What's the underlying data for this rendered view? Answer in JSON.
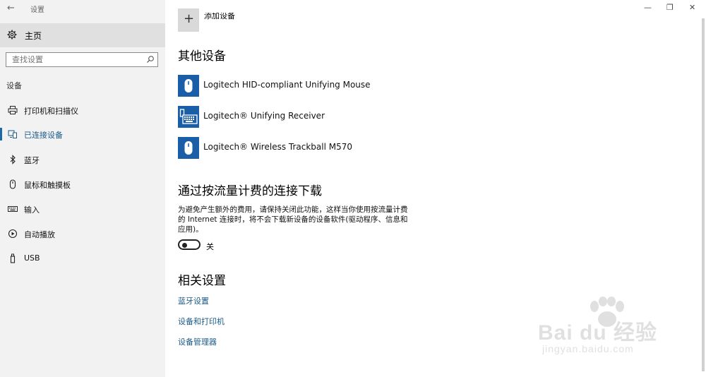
{
  "window": {
    "title": "设置"
  },
  "sidebar": {
    "home_label": "主页",
    "search_placeholder": "查找设置",
    "section": "设备",
    "items": [
      {
        "label": "打印机和扫描仪",
        "icon": "printer-icon"
      },
      {
        "label": "已连接设备",
        "icon": "connected-devices-icon",
        "active": true
      },
      {
        "label": "蓝牙",
        "icon": "bluetooth-icon"
      },
      {
        "label": "鼠标和触摸板",
        "icon": "mouse-icon"
      },
      {
        "label": "输入",
        "icon": "keyboard-icon"
      },
      {
        "label": "自动播放",
        "icon": "autoplay-icon"
      },
      {
        "label": "USB",
        "icon": "usb-icon"
      }
    ]
  },
  "main": {
    "add_device_label": "添加设备",
    "other_devices": {
      "heading": "其他设备",
      "devices": [
        {
          "name": "Logitech HID-compliant Unifying Mouse",
          "icon": "mouse-icon"
        },
        {
          "name": "Logitech® Unifying Receiver",
          "icon": "keyboard-icon"
        },
        {
          "name": "Logitech® Wireless Trackball M570",
          "icon": "mouse-icon"
        }
      ]
    },
    "metered": {
      "heading": "通过按流量计费的连接下载",
      "description": "为避免产生额外的费用，请保持关闭此功能，这样当你使用按流量计费的 Internet 连接时，将不会下载新设备的设备软件(驱动程序、信息和应用)。",
      "toggle_state": "关"
    },
    "related": {
      "heading": "相关设置",
      "links": [
        "蓝牙设置",
        "设备和打印机",
        "设备管理器"
      ]
    }
  },
  "watermark": {
    "logo": "Bai du 经验",
    "url": "jingyan.baidu.com"
  },
  "colors": {
    "accent": "#1a5a8a",
    "tile": "#1a5ea8",
    "sidebar_bg": "#f2f2f2"
  }
}
